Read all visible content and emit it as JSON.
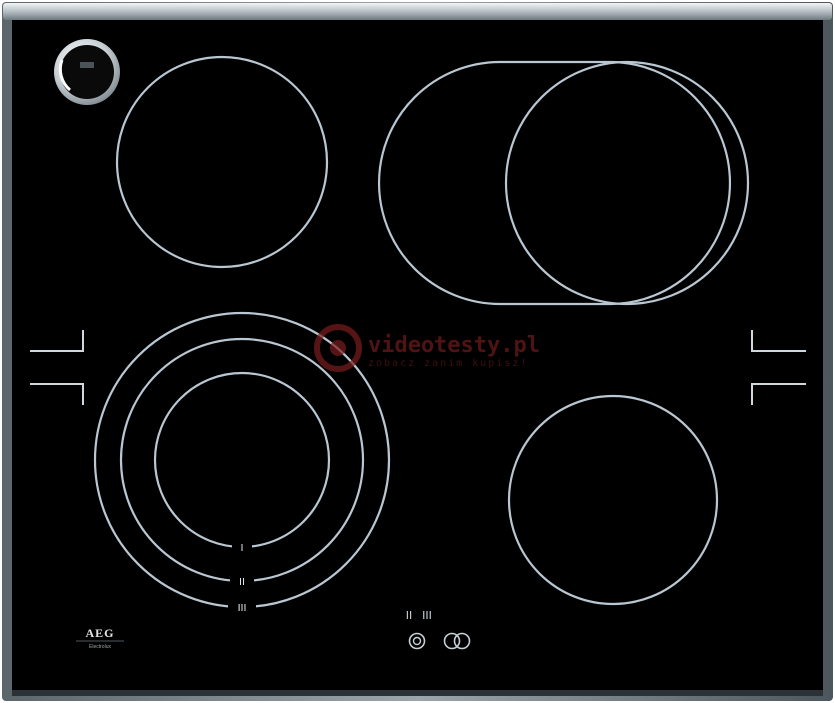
{
  "product": {
    "brand": "AEG",
    "brand_sub": "Electrolux"
  },
  "zones": {
    "dual_zone_marks": [
      "I",
      "II",
      "III"
    ]
  },
  "controls": {
    "indicator_glyphs": [
      "II",
      "III"
    ]
  },
  "watermark": {
    "prefix": "video",
    "suffix": "testy.pl",
    "tagline": "zobacz zanim kupisz!"
  },
  "colors": {
    "glass": "#000000",
    "frame": "#7f8c92",
    "rings": "#b9c7d2",
    "watermark": "#8b1d1d"
  }
}
